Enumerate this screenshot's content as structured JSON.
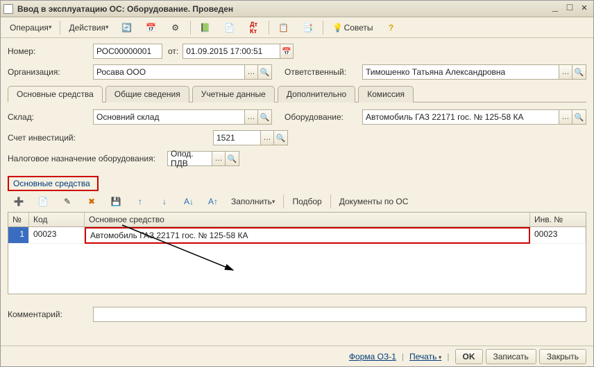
{
  "window": {
    "title": "Ввод в эксплуатацию ОС: Оборудование. Проведен"
  },
  "toolbar": {
    "operation": "Операция",
    "actions": "Действия",
    "advice": "Советы"
  },
  "fields": {
    "number_label": "Номер:",
    "number_value": "РОС00000001",
    "from_label": "от:",
    "date_value": "01.09.2015 17:00:51",
    "org_label": "Организация:",
    "org_value": "Росава ООО",
    "resp_label": "Ответственный:",
    "resp_value": "Тимошенко Татьяна Александровна",
    "warehouse_label": "Склад:",
    "warehouse_value": "Основний склад",
    "equip_label": "Оборудование:",
    "equip_value": "Автомобиль ГАЗ 22171 гос. № 125-58 КА",
    "invacct_label": "Счет инвестиций:",
    "invacct_value": "1521",
    "tax_label": "Налоговое назначение оборудования:",
    "tax_value": "Опод. ПДВ",
    "comment_label": "Комментарий:",
    "comment_value": ""
  },
  "tabs": [
    {
      "label": "Основные средства",
      "active": true
    },
    {
      "label": "Общие сведения",
      "active": false
    },
    {
      "label": "Учетные данные",
      "active": false
    },
    {
      "label": "Дополнительно",
      "active": false
    },
    {
      "label": "Комиссия",
      "active": false
    }
  ],
  "section_title": "Основные средства",
  "subtoolbar": {
    "fill": "Заполнить",
    "select": "Подбор",
    "docs": "Документы по ОС"
  },
  "grid": {
    "columns": {
      "n": "№",
      "code": "Код",
      "main": "Основное средство",
      "inv": "Инв. №"
    },
    "rows": [
      {
        "n": "1",
        "code": "00023",
        "main": "Автомобиль ГАЗ 22171 гос. № 125-58 КА",
        "inv": "00023"
      }
    ]
  },
  "footer": {
    "form": "Форма ОЗ-1",
    "print": "Печать",
    "ok": "OK",
    "save": "Записать",
    "close": "Закрыть"
  }
}
